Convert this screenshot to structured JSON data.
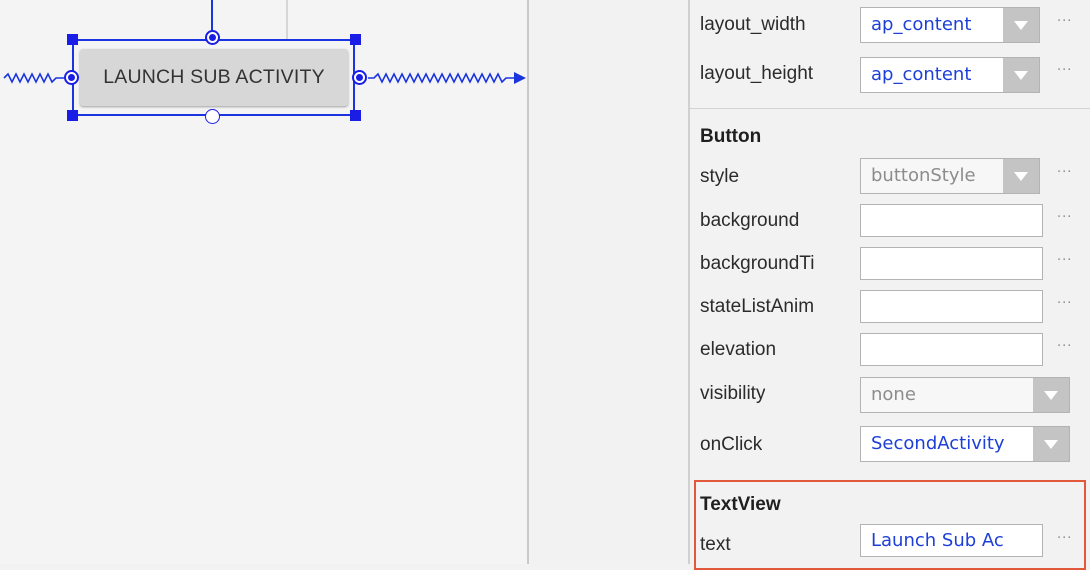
{
  "canvas": {
    "widget_text": "LAUNCH SUB ACTIVITY"
  },
  "properties": {
    "layout": [
      {
        "label": "layout_width",
        "value": "ap_content"
      },
      {
        "label": "layout_height",
        "value": "ap_content"
      }
    ],
    "button_section": {
      "title": "Button",
      "style": {
        "label": "style",
        "value": "buttonStyle"
      },
      "background": {
        "label": "background",
        "value": ""
      },
      "backgroundTint": {
        "label": "backgroundTi",
        "value": ""
      },
      "stateListAnimator": {
        "label": "stateListAnim",
        "value": ""
      },
      "elevation": {
        "label": "elevation",
        "value": ""
      },
      "visibility": {
        "label": "visibility",
        "value": "none"
      },
      "onClick": {
        "label": "onClick",
        "value": "SecondActivity"
      }
    },
    "textview_section": {
      "title": "TextView",
      "text": {
        "label": "text",
        "value": "Launch Sub Ac"
      }
    },
    "ellipsis": "···"
  },
  "colors": {
    "selection_blue": "#1a34e0",
    "value_blue": "#1d3fd8",
    "highlight_red": "#e2583a"
  },
  "icons": [
    "dropdown-arrow-icon",
    "ellipsis-icon",
    "constraint-anchor-icon",
    "resize-handle-icon"
  ]
}
